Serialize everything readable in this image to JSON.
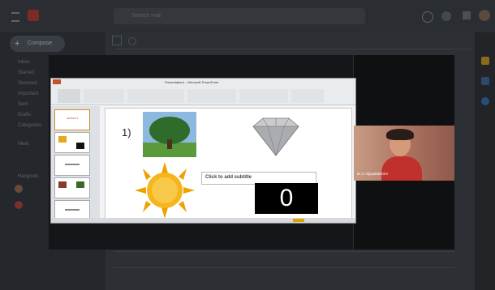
{
  "gmail": {
    "search_placeholder": "Search mail",
    "compose_label": "Compose",
    "sidebar_items": [
      "Inbox",
      "Starred",
      "Snoozed",
      "Important",
      "Sent",
      "Drafts",
      "Categories",
      "More"
    ],
    "sidebar_sections": [
      "Meet",
      "Hangouts"
    ]
  },
  "presentation": {
    "window_title": "Presentation1 - Microsoft PowerPoint",
    "slide": {
      "number_label": "1)",
      "subtitle_placeholder": "Click to add subtitle",
      "counter_value": "0"
    },
    "thumbnail_title": "LESSON 1"
  },
  "video": {
    "participant_name": "Dr.C.Vijayalakshmi"
  },
  "colors": {
    "slide_bg": "#ffffff",
    "counter_bg": "#000000",
    "counter_fg": "#ffffff"
  }
}
